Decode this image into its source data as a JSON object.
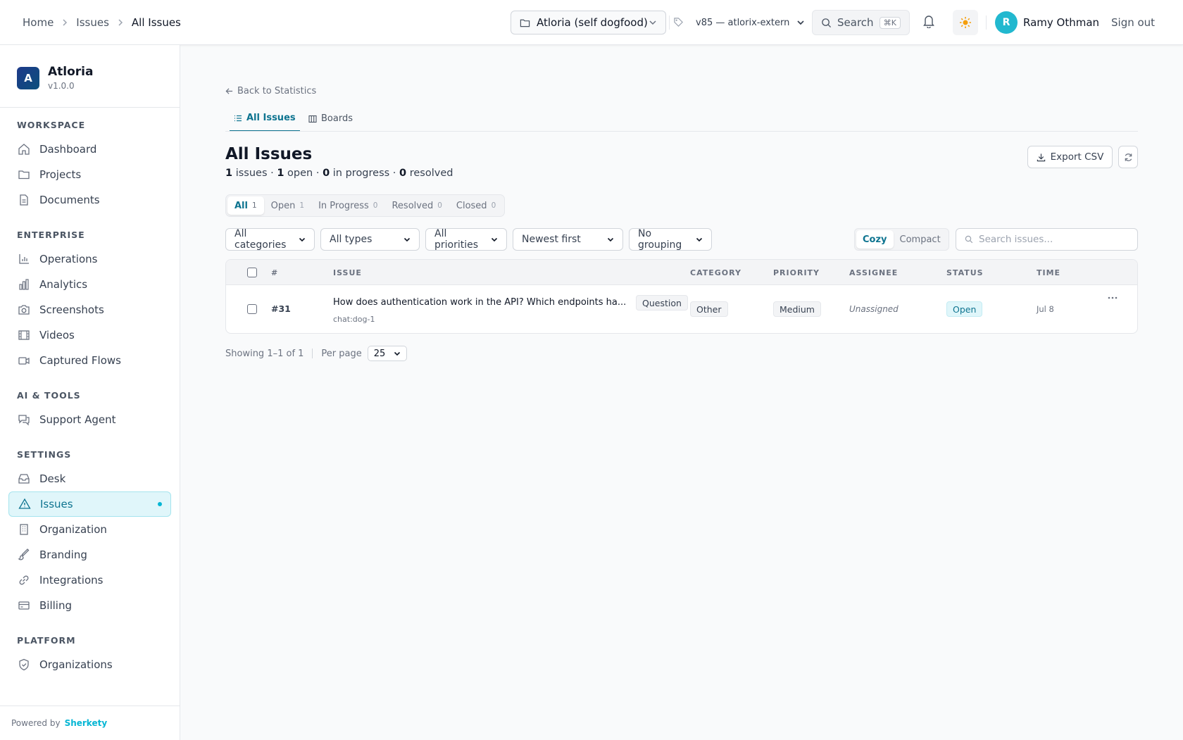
{
  "breadcrumb": {
    "items": [
      "Home",
      "Issues",
      "All Issues"
    ]
  },
  "header": {
    "workspace": "Atloria (self dogfood)",
    "version": "v85 — atlorix-extern",
    "search_label": "Search",
    "search_shortcut": "⌘K",
    "user_initial": "R",
    "user_name": "Ramy Othman",
    "signout_label": "Sign out"
  },
  "sidebar": {
    "brand_initial": "A",
    "brand_name": "Atloria",
    "brand_version": "v1.0.0",
    "sections": {
      "workspace": "WORKSPACE",
      "enterprise": "ENTERPRISE",
      "ai_tools": "AI & TOOLS",
      "settings": "SETTINGS",
      "platform": "PLATFORM"
    },
    "items": {
      "dashboard": "Dashboard",
      "projects": "Projects",
      "documents": "Documents",
      "operations": "Operations",
      "analytics": "Analytics",
      "screenshots": "Screenshots",
      "videos": "Videos",
      "captured_flows": "Captured Flows",
      "support_agent": "Support Agent",
      "desk": "Desk",
      "issues": "Issues",
      "organization": "Organization",
      "branding": "Branding",
      "integrations": "Integrations",
      "billing": "Billing",
      "organizations": "Organizations"
    },
    "powered_by": "Powered by",
    "powered_brand": "Sherkety"
  },
  "main": {
    "back_label": "Back to Statistics",
    "tabs": {
      "all_issues": "All Issues",
      "boards": "Boards"
    },
    "title": "All Issues",
    "summary": {
      "issues_count": "1",
      "issues_label": "issues ·",
      "open_count": "1",
      "open_label": "open ·",
      "progress_count": "0",
      "progress_label": "in progress ·",
      "resolved_count": "0",
      "resolved_label": "resolved"
    },
    "export_label": "Export CSV",
    "status_tabs": [
      {
        "label": "All",
        "count": "1"
      },
      {
        "label": "Open",
        "count": "1"
      },
      {
        "label": "In Progress",
        "count": "0"
      },
      {
        "label": "Resolved",
        "count": "0"
      },
      {
        "label": "Closed",
        "count": "0"
      }
    ],
    "filters": {
      "category": "All categories",
      "type": "All types",
      "priority": "All priorities",
      "sort": "Newest first",
      "grouping": "No grouping"
    },
    "density": {
      "cozy": "Cozy",
      "compact": "Compact"
    },
    "search_placeholder": "Search issues...",
    "table": {
      "headers": {
        "num": "#",
        "issue": "ISSUE",
        "category": "CATEGORY",
        "priority": "PRIORITY",
        "assignee": "ASSIGNEE",
        "status": "STATUS",
        "time": "TIME"
      },
      "rows": [
        {
          "num": "#31",
          "title": "How does authentication work in the API? Which endpoints ha...",
          "type": "Question",
          "source": "chat:dog-1",
          "category": "Other",
          "priority": "Medium",
          "assignee": "Unassigned",
          "status": "Open",
          "time": "Jul 8"
        }
      ]
    },
    "pager": {
      "showing": "Showing 1–1 of 1",
      "per_page_label": "Per page",
      "per_page_value": "25"
    }
  },
  "colors": {
    "accent": "#0e7490",
    "accent_light": "#e0f6fa",
    "brand": "#06b6d4"
  }
}
